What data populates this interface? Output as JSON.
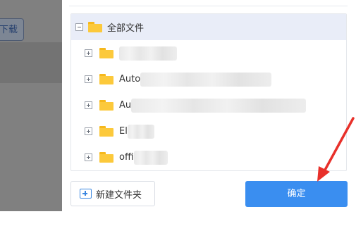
{
  "background": {
    "download_label": "下载"
  },
  "dialog": {
    "root": {
      "label": "全部文件",
      "expander": "minus"
    },
    "folders": [
      {
        "label": "",
        "expander": "plus"
      },
      {
        "label": "Auto",
        "expander": "plus"
      },
      {
        "label": "Au",
        "expander": "plus"
      },
      {
        "label": "El",
        "expander": "plus"
      },
      {
        "label": "offi",
        "expander": "plus"
      }
    ],
    "new_folder_label": "新建文件夹",
    "confirm_label": "确定"
  },
  "colors": {
    "accent": "#3a8ef0",
    "folder": "#fcc93b",
    "annotation_arrow": "#e8302a"
  },
  "icons": {
    "folder": "folder-icon",
    "new_folder": "new-folder-icon",
    "expander": "expander-icon"
  }
}
